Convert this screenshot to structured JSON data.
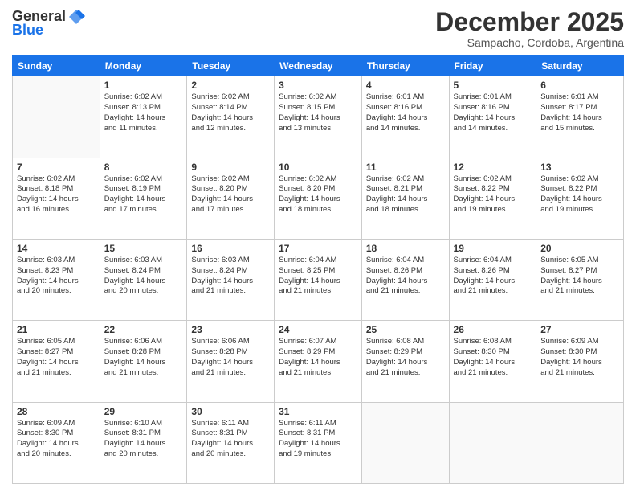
{
  "logo": {
    "general": "General",
    "blue": "Blue"
  },
  "header": {
    "month": "December 2025",
    "location": "Sampacho, Cordoba, Argentina"
  },
  "weekdays": [
    "Sunday",
    "Monday",
    "Tuesday",
    "Wednesday",
    "Thursday",
    "Friday",
    "Saturday"
  ],
  "weeks": [
    [
      {
        "day": "",
        "info": ""
      },
      {
        "day": "1",
        "info": "Sunrise: 6:02 AM\nSunset: 8:13 PM\nDaylight: 14 hours\nand 11 minutes."
      },
      {
        "day": "2",
        "info": "Sunrise: 6:02 AM\nSunset: 8:14 PM\nDaylight: 14 hours\nand 12 minutes."
      },
      {
        "day": "3",
        "info": "Sunrise: 6:02 AM\nSunset: 8:15 PM\nDaylight: 14 hours\nand 13 minutes."
      },
      {
        "day": "4",
        "info": "Sunrise: 6:01 AM\nSunset: 8:16 PM\nDaylight: 14 hours\nand 14 minutes."
      },
      {
        "day": "5",
        "info": "Sunrise: 6:01 AM\nSunset: 8:16 PM\nDaylight: 14 hours\nand 14 minutes."
      },
      {
        "day": "6",
        "info": "Sunrise: 6:01 AM\nSunset: 8:17 PM\nDaylight: 14 hours\nand 15 minutes."
      }
    ],
    [
      {
        "day": "7",
        "info": "Sunrise: 6:02 AM\nSunset: 8:18 PM\nDaylight: 14 hours\nand 16 minutes."
      },
      {
        "day": "8",
        "info": "Sunrise: 6:02 AM\nSunset: 8:19 PM\nDaylight: 14 hours\nand 17 minutes."
      },
      {
        "day": "9",
        "info": "Sunrise: 6:02 AM\nSunset: 8:20 PM\nDaylight: 14 hours\nand 17 minutes."
      },
      {
        "day": "10",
        "info": "Sunrise: 6:02 AM\nSunset: 8:20 PM\nDaylight: 14 hours\nand 18 minutes."
      },
      {
        "day": "11",
        "info": "Sunrise: 6:02 AM\nSunset: 8:21 PM\nDaylight: 14 hours\nand 18 minutes."
      },
      {
        "day": "12",
        "info": "Sunrise: 6:02 AM\nSunset: 8:22 PM\nDaylight: 14 hours\nand 19 minutes."
      },
      {
        "day": "13",
        "info": "Sunrise: 6:02 AM\nSunset: 8:22 PM\nDaylight: 14 hours\nand 19 minutes."
      }
    ],
    [
      {
        "day": "14",
        "info": "Sunrise: 6:03 AM\nSunset: 8:23 PM\nDaylight: 14 hours\nand 20 minutes."
      },
      {
        "day": "15",
        "info": "Sunrise: 6:03 AM\nSunset: 8:24 PM\nDaylight: 14 hours\nand 20 minutes."
      },
      {
        "day": "16",
        "info": "Sunrise: 6:03 AM\nSunset: 8:24 PM\nDaylight: 14 hours\nand 21 minutes."
      },
      {
        "day": "17",
        "info": "Sunrise: 6:04 AM\nSunset: 8:25 PM\nDaylight: 14 hours\nand 21 minutes."
      },
      {
        "day": "18",
        "info": "Sunrise: 6:04 AM\nSunset: 8:26 PM\nDaylight: 14 hours\nand 21 minutes."
      },
      {
        "day": "19",
        "info": "Sunrise: 6:04 AM\nSunset: 8:26 PM\nDaylight: 14 hours\nand 21 minutes."
      },
      {
        "day": "20",
        "info": "Sunrise: 6:05 AM\nSunset: 8:27 PM\nDaylight: 14 hours\nand 21 minutes."
      }
    ],
    [
      {
        "day": "21",
        "info": "Sunrise: 6:05 AM\nSunset: 8:27 PM\nDaylight: 14 hours\nand 21 minutes."
      },
      {
        "day": "22",
        "info": "Sunrise: 6:06 AM\nSunset: 8:28 PM\nDaylight: 14 hours\nand 21 minutes."
      },
      {
        "day": "23",
        "info": "Sunrise: 6:06 AM\nSunset: 8:28 PM\nDaylight: 14 hours\nand 21 minutes."
      },
      {
        "day": "24",
        "info": "Sunrise: 6:07 AM\nSunset: 8:29 PM\nDaylight: 14 hours\nand 21 minutes."
      },
      {
        "day": "25",
        "info": "Sunrise: 6:08 AM\nSunset: 8:29 PM\nDaylight: 14 hours\nand 21 minutes."
      },
      {
        "day": "26",
        "info": "Sunrise: 6:08 AM\nSunset: 8:30 PM\nDaylight: 14 hours\nand 21 minutes."
      },
      {
        "day": "27",
        "info": "Sunrise: 6:09 AM\nSunset: 8:30 PM\nDaylight: 14 hours\nand 21 minutes."
      }
    ],
    [
      {
        "day": "28",
        "info": "Sunrise: 6:09 AM\nSunset: 8:30 PM\nDaylight: 14 hours\nand 20 minutes."
      },
      {
        "day": "29",
        "info": "Sunrise: 6:10 AM\nSunset: 8:31 PM\nDaylight: 14 hours\nand 20 minutes."
      },
      {
        "day": "30",
        "info": "Sunrise: 6:11 AM\nSunset: 8:31 PM\nDaylight: 14 hours\nand 20 minutes."
      },
      {
        "day": "31",
        "info": "Sunrise: 6:11 AM\nSunset: 8:31 PM\nDaylight: 14 hours\nand 19 minutes."
      },
      {
        "day": "",
        "info": ""
      },
      {
        "day": "",
        "info": ""
      },
      {
        "day": "",
        "info": ""
      }
    ]
  ]
}
